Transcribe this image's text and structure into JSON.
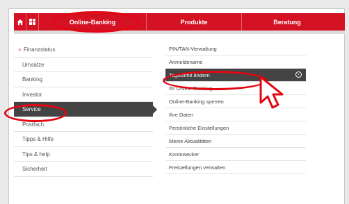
{
  "topnav": {
    "home_icon": "home-icon",
    "grid_icon": "grid-icon",
    "tabs": [
      {
        "label": "Online-Banking"
      },
      {
        "label": "Produkte"
      },
      {
        "label": "Beratung"
      }
    ]
  },
  "left_menu": {
    "items": [
      {
        "label": "Finanzstatus"
      },
      {
        "label": "Umsätze"
      },
      {
        "label": "Banking"
      },
      {
        "label": "Investor"
      },
      {
        "label": "Service"
      },
      {
        "label": "Postfach"
      },
      {
        "label": "Tipps & Hilfe"
      },
      {
        "label": "Tips & help"
      },
      {
        "label": "Sicherheit"
      }
    ]
  },
  "right_menu": {
    "items": [
      {
        "label": "PIN/TAN-Verwaltung"
      },
      {
        "label": "Anmeldename"
      },
      {
        "label": "Tageslimit ändern"
      },
      {
        "label": "Ihr Online-Banking"
      },
      {
        "label": "Online-Banking sperren"
      },
      {
        "label": "Ihre Daten"
      },
      {
        "label": "Persönliche Einstellungen"
      },
      {
        "label": "Meine Aktualitäten"
      },
      {
        "label": "Kontowecker"
      },
      {
        "label": "Freistellungen verwalten"
      }
    ]
  },
  "colors": {
    "brand_red": "#d51124",
    "active_dark": "#444444",
    "highlight_red": "#e30613"
  }
}
